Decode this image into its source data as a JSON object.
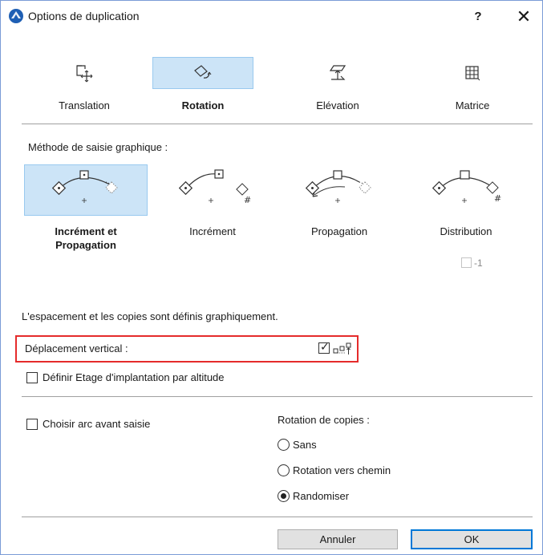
{
  "window": {
    "title": "Options de duplication",
    "help_label": "?",
    "close_label": "✕"
  },
  "modes": [
    {
      "label": "Translation",
      "icon": "translation-icon",
      "selected": false
    },
    {
      "label": "Rotation",
      "icon": "rotation-icon",
      "selected": true
    },
    {
      "label": "Elévation",
      "icon": "elevation-icon",
      "selected": false
    },
    {
      "label": "Matrice",
      "icon": "matrix-icon",
      "selected": false
    }
  ],
  "method_section": {
    "label": "Méthode de saisie graphique :"
  },
  "methods": [
    {
      "label": "Incrément et Propagation",
      "icon": "increment-propagation-icon",
      "selected": true
    },
    {
      "label": "Incrément",
      "icon": "increment-icon",
      "selected": false
    },
    {
      "label": "Propagation",
      "icon": "propagation-icon",
      "selected": false
    },
    {
      "label": "Distribution",
      "icon": "distribution-icon",
      "selected": false
    }
  ],
  "distribution_minus_one": {
    "label": "-1",
    "checked": false
  },
  "info_text": "L'espacement et les copies sont définis graphiquement.",
  "vertical_shift": {
    "label": "Déplacement vertical :",
    "checked": true,
    "icon": "vertical-shift-icon"
  },
  "define_story": {
    "label": "Définir Etage d'implantation par altitude",
    "checked": false
  },
  "choose_arc": {
    "label": "Choisir arc avant saisie",
    "checked": false
  },
  "copy_rotation": {
    "label": "Rotation de copies :",
    "options": [
      {
        "label": "Sans",
        "checked": false
      },
      {
        "label": "Rotation vers chemin",
        "checked": false
      },
      {
        "label": "Randomiser",
        "checked": true
      }
    ]
  },
  "buttons": {
    "cancel": "Annuler",
    "ok": "OK"
  },
  "colors": {
    "selection_bg": "#cce4f7",
    "selection_border": "#99c9ef",
    "highlight_red": "#e52b2b",
    "ok_border": "#0078d7"
  }
}
